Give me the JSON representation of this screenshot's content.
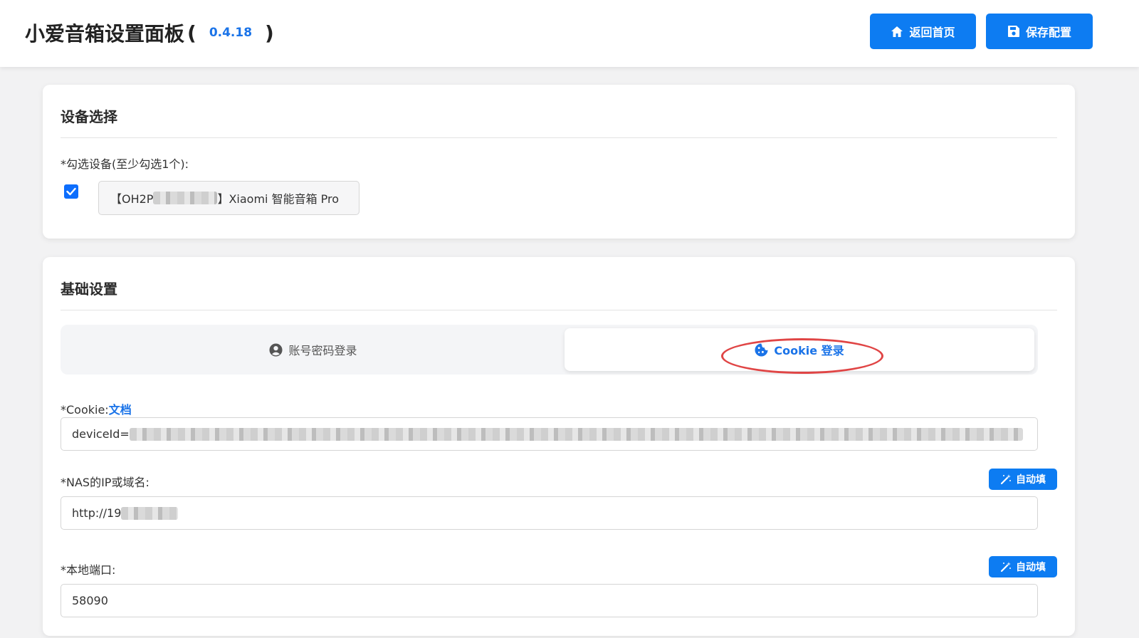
{
  "header": {
    "title": "小爱音箱设置面板",
    "paren_open": "(",
    "version": "0.4.18",
    "paren_close": ")",
    "home_button": "返回首页",
    "save_button": "保存配置"
  },
  "device_section": {
    "title": "设备选择",
    "select_label": "*勾选设备(至少勾选1个):",
    "device": {
      "checked": true,
      "prefix": "【OH2P",
      "suffix": "】Xiaomi 智能音箱 Pro"
    }
  },
  "basic_section": {
    "title": "基础设置",
    "tabs": [
      {
        "label": "账号密码登录",
        "icon": "user-circle-icon",
        "active": false
      },
      {
        "label": "Cookie 登录",
        "icon": "cookie-icon",
        "active": true
      }
    ],
    "cookie": {
      "label_prefix": "*Cookie:",
      "doc_link": "文档",
      "value": "deviceId="
    },
    "nas": {
      "label": "*NAS的IP或域名:",
      "autofill": "自动填",
      "value": "http://19"
    },
    "port": {
      "label": "*本地端口:",
      "autofill": "自动填",
      "value": "58090"
    }
  },
  "colors": {
    "accent": "#0d7cf2",
    "annotation": "#e04545",
    "background": "#f2f2f3"
  }
}
